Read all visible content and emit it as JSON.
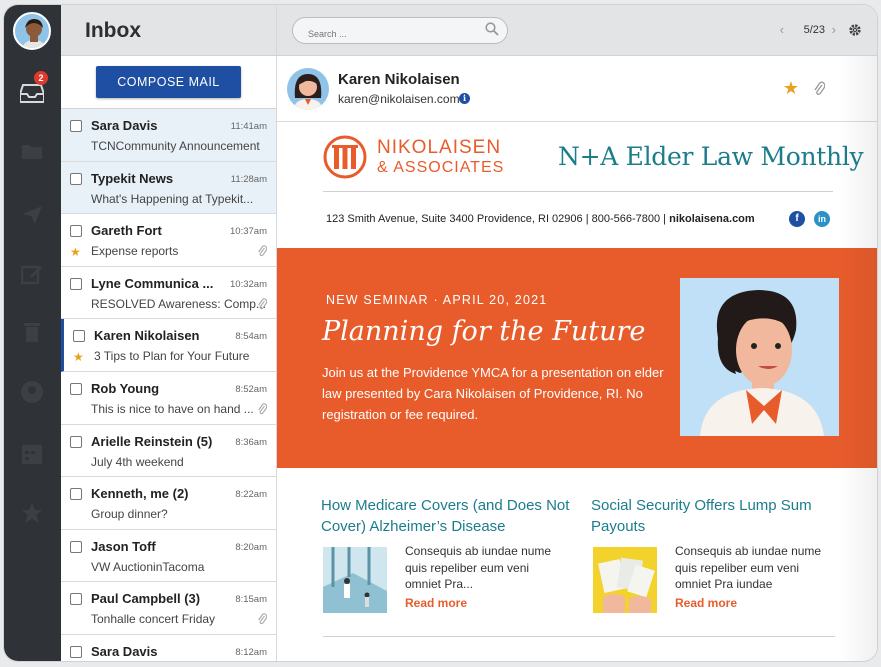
{
  "app": {
    "title": "Inbox",
    "compose_label": "COMPOSE  MAIL",
    "unread_badge": "2"
  },
  "toolbar": {
    "search_placeholder": "Search ...",
    "pager": "5/23"
  },
  "mails": [
    {
      "from": "Sara Davis",
      "time": "11:41am",
      "subject": "TCNCommunity Announcement",
      "selected": true,
      "starred": false,
      "attachment": false
    },
    {
      "from": "Typekit News",
      "time": "11:28am",
      "subject": "What's Happening at Typekit...",
      "selected": true,
      "starred": false,
      "attachment": false
    },
    {
      "from": "Gareth Fort",
      "time": "10:37am",
      "subject": "Expense reports",
      "selected": false,
      "starred": true,
      "attachment": true
    },
    {
      "from": "Lyne Communica ...",
      "time": "10:32am",
      "subject": "RESOLVED Awareness: Comp...",
      "selected": false,
      "starred": false,
      "attachment": true
    },
    {
      "from": "Karen Nikolaisen",
      "time": "8:54am",
      "subject": "3 Tips to Plan for Your Future",
      "selected": false,
      "starred": true,
      "attachment": false,
      "active": true
    },
    {
      "from": "Rob Young",
      "time": "8:52am",
      "subject": "This is nice to have on hand ...",
      "selected": false,
      "starred": false,
      "attachment": true
    },
    {
      "from": "Arielle Reinstein  (5)",
      "time": "8:36am",
      "subject": "July 4th weekend",
      "selected": false,
      "starred": false,
      "attachment": false
    },
    {
      "from": "Kenneth, me  (2)",
      "time": "8:22am",
      "subject": "Group dinner?",
      "selected": false,
      "starred": false,
      "attachment": false
    },
    {
      "from": "Jason Toff",
      "time": "8:20am",
      "subject": "VW AuctioninTacoma",
      "selected": false,
      "starred": false,
      "attachment": false
    },
    {
      "from": "Paul Campbell  (3)",
      "time": "8:15am",
      "subject": "Tonhalle concert Friday",
      "selected": false,
      "starred": false,
      "attachment": true
    },
    {
      "from": "Sara Davis",
      "time": "8:12am",
      "subject": "",
      "selected": false,
      "starred": false,
      "attachment": false
    }
  ],
  "message": {
    "sender_name": "Karen Nikolaisen",
    "sender_email": "karen@nikolaisen.com"
  },
  "newsletter": {
    "logo_line1": "NIKOLAISEN",
    "logo_line2": "& ASSOCIATES",
    "title": "N+A Elder Law Monthly",
    "address": "123 Smith Avenue, Suite 3400   Providence, RI  02906  |  800-566-7800  |",
    "website": "nikolaisena.com",
    "banner": {
      "kicker": "NEW SEMINAR · APRIL 20, 2021",
      "headline": "Planning for the Future",
      "body": "Join us at the Providence YMCA for a presentation on elder law presented by Cara Nikolaisen of Providence, RI. No registration or fee required."
    },
    "articles": [
      {
        "title": "How Medicare Covers (and Does Not Cover) Alzheimer’s Disease",
        "excerpt": "Consequis ab iundae nume quis repeliber eum veni omniet Pra...",
        "more": "Read more"
      },
      {
        "title": "Social Security Offers Lump Sum Payouts",
        "excerpt": "Consequis ab iundae nume quis repeliber eum veni omniet Pra iundae",
        "more": "Read more"
      }
    ]
  },
  "colors": {
    "brand_orange": "#e85c2c",
    "brand_teal": "#1b7d8c",
    "compose_blue": "#1f4fa3",
    "star": "#e8a21c"
  }
}
